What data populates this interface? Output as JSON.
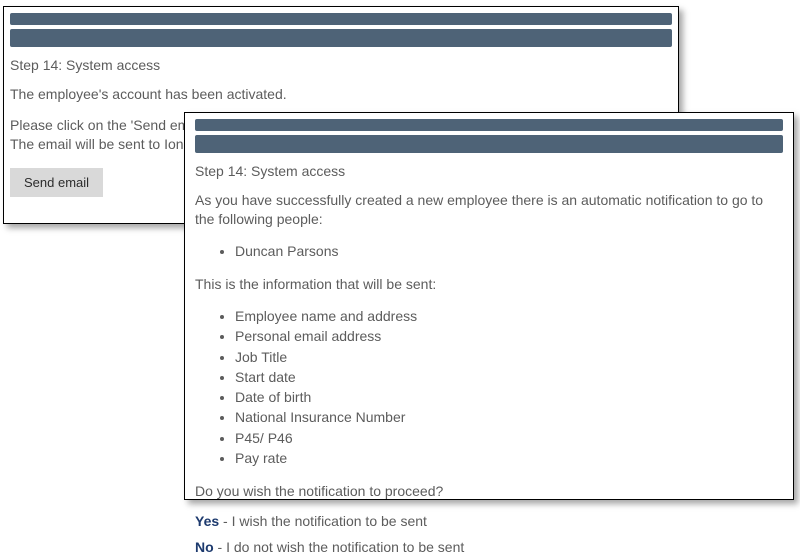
{
  "back_panel": {
    "step_title": "Step 14: System access",
    "activated_text": "The employee's account has been activated.",
    "instruction_line1": "Please click on the 'Send email",
    "instruction_line2": "The email will be sent to Iona.",
    "send_button_label": "Send email"
  },
  "front_panel": {
    "step_title": "Step 14: System access",
    "intro_text": "As you have successfully created a new employee there is an automatic notification to go to the following people:",
    "people": [
      "Duncan Parsons"
    ],
    "info_heading": "This is the information that will be sent:",
    "info_items": [
      "Employee name and address",
      "Personal email address",
      "Job Title",
      "Start date",
      "Date of birth",
      "National Insurance Number",
      "P45/ P46",
      "Pay rate"
    ],
    "proceed_question": "Do you wish the notification to proceed?",
    "yes_key": "Yes",
    "yes_text": " - I wish the notification to be sent",
    "no_key": "No",
    "no_text": " - I do not wish the notification to be sent"
  }
}
